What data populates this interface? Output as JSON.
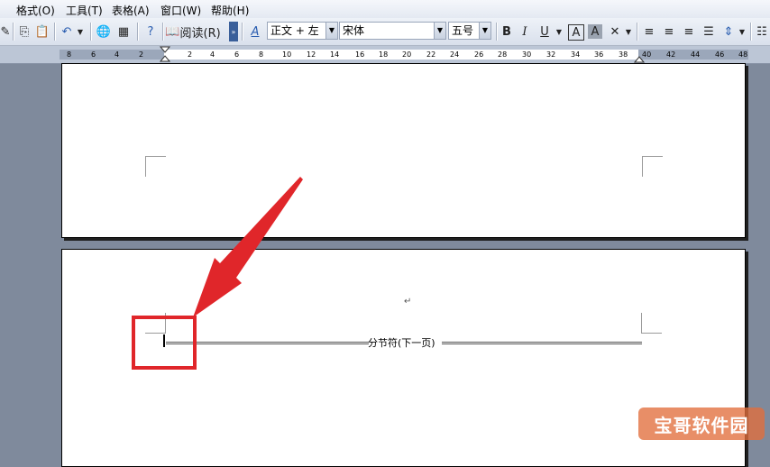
{
  "menu": {
    "items": [
      "格式(O)",
      "工具(T)",
      "表格(A)",
      "窗口(W)",
      "帮助(H)"
    ]
  },
  "toolbar": {
    "read_label": "阅读(R)",
    "style_value": "正文 + 左",
    "font_value": "宋体",
    "size_value": "五号",
    "bold_label": "B",
    "italic_label": "I",
    "underline_label": "U",
    "charborder_label": "A",
    "charshade_label": "A"
  },
  "ruler": {
    "ticks": [
      "8",
      "6",
      "4",
      "2",
      "2",
      "4",
      "6",
      "8",
      "10",
      "12",
      "14",
      "16",
      "18",
      "20",
      "22",
      "24",
      "26",
      "28",
      "30",
      "32",
      "34",
      "36",
      "38",
      "40",
      "42",
      "44",
      "46",
      "48"
    ]
  },
  "document": {
    "section_break_label": "分节符(下一页)",
    "paragraph_mark": "↵"
  },
  "watermark": {
    "text": "宝哥软件园"
  },
  "colors": {
    "highlight": "#e0262a",
    "arrow": "#e0262a",
    "workspace": "#7f8a9c"
  }
}
